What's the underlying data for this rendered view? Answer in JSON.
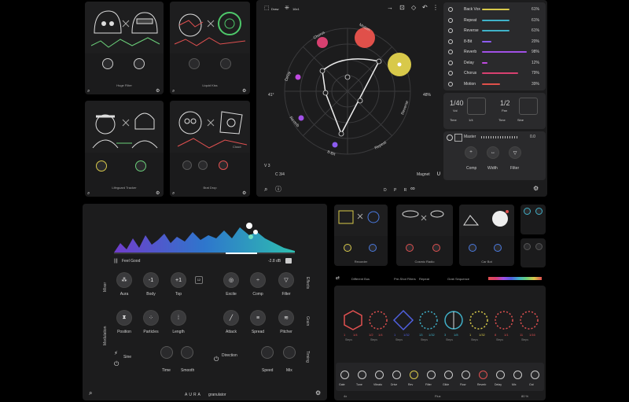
{
  "panels": {
    "p1": {
      "title": "Huge Filter"
    },
    "p2": {
      "title": "Liquid Kiss"
    },
    "p3": {
      "title": "Lifeguard Tracker"
    },
    "p4": {
      "title": "Brat Drop"
    },
    "p4_badge": "Cloud"
  },
  "mixer": {
    "toolbar": {
      "draw": "Draw",
      "ratio": "16x1"
    },
    "axis_labels": [
      "Chorus",
      "Motion",
      "Delay",
      "Reverb",
      "Reverse",
      "8-Bit",
      "Repeat",
      "Back Vox"
    ],
    "left_value": "41°",
    "right_value": "48%",
    "bottom_left": "V 3",
    "bottom_left2": "C 3/4",
    "magnet_label": "Magnet",
    "center_label": "D P R",
    "fx": [
      {
        "name": "Back Vox",
        "value": "61%",
        "color": "#d8c94a",
        "fill": 0.61
      },
      {
        "name": "Repeat",
        "value": "61%",
        "color": "#3fb2c8",
        "fill": 0.61
      },
      {
        "name": "Reverse",
        "value": "61%",
        "color": "#3fb2c8",
        "fill": 0.61
      },
      {
        "name": "8-Bit",
        "value": "20%",
        "color": "#8c5cf0",
        "fill": 0.2
      },
      {
        "name": "Reverb",
        "value": "98%",
        "color": "#a150e6",
        "fill": 0.98
      },
      {
        "name": "Delay",
        "value": "12%",
        "color": "#c04ae0",
        "fill": 0.12
      },
      {
        "name": "Chorus",
        "value": "79%",
        "color": "#d84070",
        "fill": 0.79
      },
      {
        "name": "Motion",
        "value": "39%",
        "color": "#e0504a",
        "fill": 0.39
      }
    ],
    "vol": {
      "value": "1/40",
      "label": "Vol",
      "time": "Time",
      "time_val": "1/4"
    },
    "pan": {
      "value": "1/2",
      "label": "Pan",
      "time": "Time",
      "shape": "Sine"
    },
    "master_label": "Master",
    "master_value": "0.0",
    "master_knobs": [
      "Comp",
      "Width",
      "Filter"
    ]
  },
  "aura": {
    "preset": "Feel Good",
    "level": "-2.8 dB",
    "brand": "AURA",
    "brand_sub": "granulator",
    "sections": {
      "mixer": "Mixer",
      "modulation": "Modulation",
      "effects": "Effects",
      "grain": "Grain",
      "timing": "Timing"
    },
    "row1": [
      {
        "label": "Aura",
        "glyph": "⁂"
      },
      {
        "label": "Body",
        "glyph": "-1"
      },
      {
        "label": "Top",
        "glyph": "+1"
      },
      {
        "label": "Excite",
        "glyph": "◎"
      },
      {
        "label": "Comp",
        "glyph": "÷"
      },
      {
        "label": "Filter",
        "glyph": "▽"
      }
    ],
    "row1_badge": "12",
    "row2": [
      {
        "label": "Position",
        "glyph": "⧗"
      },
      {
        "label": "Particles",
        "glyph": "⁘"
      },
      {
        "label": "Length",
        "glyph": "⁞"
      },
      {
        "label": "Attack",
        "glyph": "╱"
      },
      {
        "label": "Spread",
        "glyph": "≡"
      },
      {
        "label": "Pitcher",
        "glyph": "≋"
      }
    ],
    "mod_shape": "Sine",
    "mod_knobs": [
      "Time",
      "Smooth"
    ],
    "dir_label": "Direction",
    "dir_knobs": [
      "Speed",
      "Mix"
    ]
  },
  "seq": {
    "bar": {
      "left": "Different Bus",
      "mid": "Pre-Shot Filters",
      "repeat": "Repeat",
      "right": "Grab Sequence"
    },
    "steps": [
      {
        "shape": "hex",
        "color": "#e05050",
        "a": "1",
        "b": "1/4",
        "c": "Steps"
      },
      {
        "shape": "circle",
        "color": "#e05050",
        "a": "1/2",
        "b": "1/4",
        "c": "Steps"
      },
      {
        "shape": "diamond",
        "color": "#5060e0",
        "a": "1",
        "b": "1/32",
        "c": "Steps"
      },
      {
        "shape": "circle",
        "color": "#40b0c8",
        "a": "13",
        "b": "1/32",
        "c": "Steps"
      },
      {
        "shape": "split",
        "color": "#40b0c8",
        "a": "3",
        "b": "1/8",
        "c": "Steps"
      },
      {
        "shape": "circle",
        "color": "#d8c94a",
        "a": "1",
        "b": "1/32",
        "c": "Steps"
      },
      {
        "shape": "circle",
        "color": "#e05050",
        "a": "8",
        "b": "1/1",
        "c": "Steps"
      },
      {
        "shape": "circle",
        "color": "#e05050",
        "a": "11",
        "b": "1/16",
        "c": "Steps"
      }
    ],
    "bottom_labels": [
      "Gate",
      "Tune",
      "Vibrato",
      "Drive",
      "Rev",
      "Filter",
      "Glide",
      "Flow",
      "Reverb",
      "Delay",
      "Mix",
      "Out"
    ],
    "footer": "Flux",
    "footer_left": "4x",
    "footer_right": "80 %"
  },
  "minis": {
    "m1": "Recorder",
    "m2": "Cosmic Radio",
    "m3": "Car Bot"
  }
}
